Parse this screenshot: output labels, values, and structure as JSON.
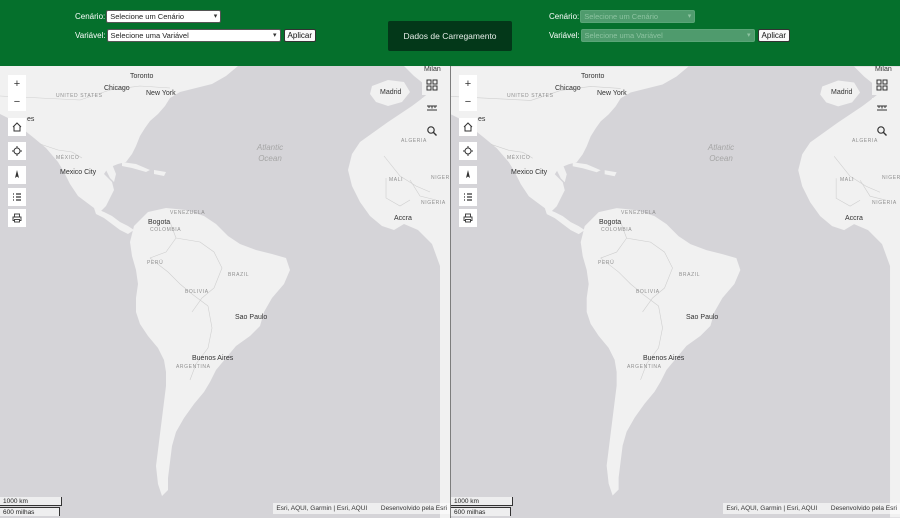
{
  "header": {
    "left": {
      "cenario_label": "Cenário:",
      "cenario_value": "Selecione um Cenário",
      "variavel_label": "Variável:",
      "variavel_value": "Selecione uma Variável",
      "apply_label": "Aplicar"
    },
    "center_button": "Dados de Carregamento",
    "right": {
      "cenario_label": "Cenário:",
      "cenario_value": "Selecione um Cenário",
      "variavel_label": "Variável:",
      "variavel_value": "Selecione uma Variável",
      "apply_label": "Aplicar"
    }
  },
  "map": {
    "places": {
      "toronto": "Toronto",
      "chicago": "Chicago",
      "new_york": "New York",
      "es": "es",
      "madrid": "Madrid",
      "milan": "Milan",
      "mexico_city": "Mexico City",
      "bogota": "Bogota",
      "sao_paulo": "Sao Paulo",
      "buenos_aires": "Buenos Aires",
      "accra": "Accra"
    },
    "countries": {
      "usa": "UNITED STATES",
      "mexico": "MÉXICO",
      "venezuela": "VENEZUELA",
      "colombia": "COLOMBIA",
      "peru": "PERÚ",
      "brazil": "BRAZIL",
      "bolivia": "BOLIVIA",
      "argentina": "ARGENTINA",
      "algeria": "ALGERIA",
      "mali": "MALI",
      "niger": "NIGER",
      "nigeria": "NIGERIA"
    },
    "ocean_line1": "Atlantic",
    "ocean_line2": "Ocean",
    "scale_km": "1000 km",
    "scale_mi": "600 milhas",
    "attribution_left": "Esri, AQUI, Garmin | Esri, AQUI",
    "attribution_right": "Desenvolvido pela Esri",
    "controls": {
      "zoom_in": "+",
      "zoom_out": "−"
    }
  },
  "colors": {
    "header_bg": "#05702c",
    "center_button_bg": "#033819",
    "land": "#f1f1f1",
    "water": "#d5d4d8"
  }
}
